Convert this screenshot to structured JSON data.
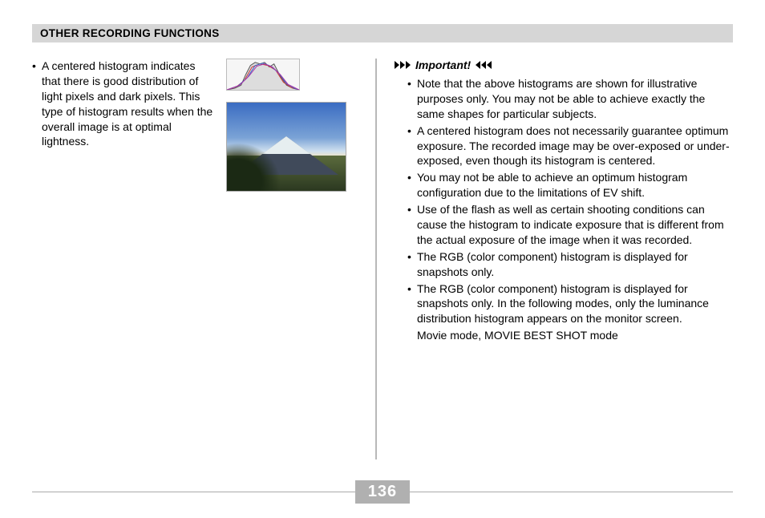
{
  "header": "OTHER RECORDING FUNCTIONS",
  "page_number": "136",
  "left": {
    "bullet": "A centered histogram indicates that there is good distribution of light pixels and dark pixels. This type of histogram results when the overall image is at optimal lightness."
  },
  "right": {
    "important_label": "Important!",
    "bullets": [
      "Note that the above histograms are shown for illustrative purposes only. You may not be able to achieve exactly the same shapes for particular subjects.",
      "A centered histogram does not necessarily guarantee optimum exposure. The recorded image may be over-exposed or under-exposed, even though its histogram is centered.",
      "You may not be able to achieve an optimum histogram configuration due to the limitations of EV shift.",
      "Use of the flash as well as certain shooting conditions can cause the histogram to indicate exposure that is different from the actual exposure of the image when it was recorded.",
      "The RGB (color component) histogram is displayed for snapshots only.",
      "The RGB (color component) histogram is displayed for snapshots only. In the following modes, only the luminance distribution histogram appears on the monitor screen."
    ],
    "continuation": "Movie mode, MOVIE BEST SHOT mode"
  },
  "illustrations": {
    "histogram_desc": "centered RGB histogram",
    "photo_desc": "snow-capped mountain landscape"
  }
}
